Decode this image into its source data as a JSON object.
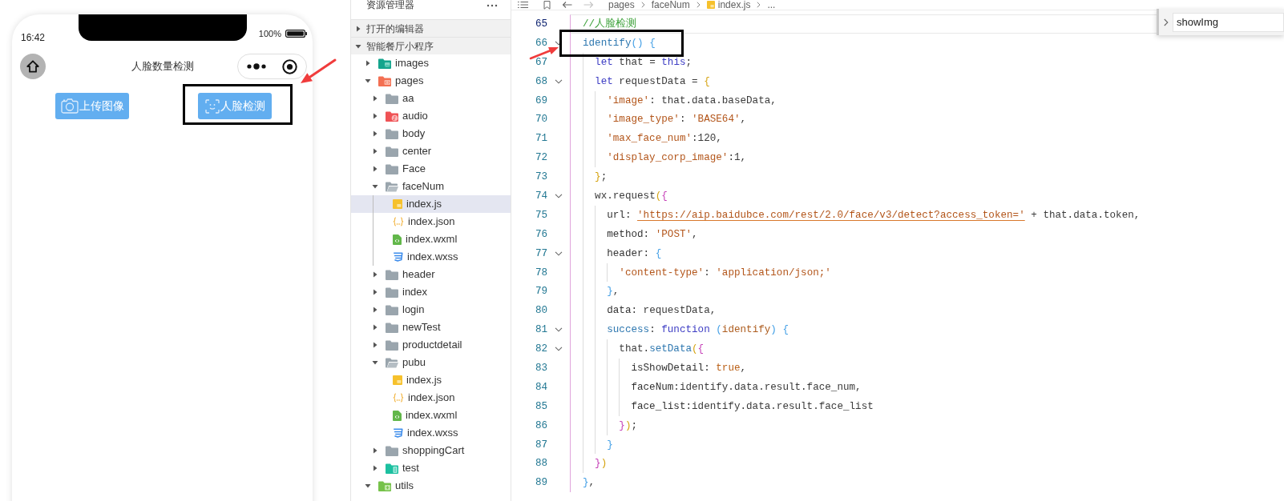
{
  "phone": {
    "status_bar": {
      "time": "16:42",
      "battery": "100%"
    },
    "nav_bar": {
      "title": "人脸数量检测"
    },
    "buttons": [
      {
        "label": "上传图像",
        "kind": "camera"
      },
      {
        "label": "人脸检测",
        "kind": "face-scan"
      }
    ]
  },
  "explorer": {
    "title": "资源管理器",
    "sections": [
      {
        "label": "打开的编辑器",
        "expanded": false
      },
      {
        "label": "智能餐厅小程序",
        "expanded": true,
        "children": [
          {
            "label": "images",
            "kind": "images",
            "expanded": false,
            "selected": false
          },
          {
            "label": "pages",
            "kind": "pages",
            "expanded": true,
            "selected": false,
            "children": [
              {
                "label": "aa",
                "kind": "folder",
                "expanded": false,
                "selected": false
              },
              {
                "label": "audio",
                "kind": "audio",
                "expanded": false,
                "selected": false
              },
              {
                "label": "body",
                "kind": "folder",
                "expanded": false,
                "selected": false
              },
              {
                "label": "center",
                "kind": "folder",
                "expanded": false,
                "selected": false
              },
              {
                "label": "Face",
                "kind": "folder",
                "expanded": false,
                "selected": false
              },
              {
                "label": "faceNum",
                "kind": "folder",
                "expanded": true,
                "selected": false,
                "children": [
                  {
                    "label": "index.js",
                    "kind": "js",
                    "selected": true
                  },
                  {
                    "label": "index.json",
                    "kind": "json",
                    "selected": false
                  },
                  {
                    "label": "index.wxml",
                    "kind": "wxml",
                    "selected": false
                  },
                  {
                    "label": "index.wxss",
                    "kind": "wxss",
                    "selected": false
                  }
                ]
              },
              {
                "label": "header",
                "kind": "folder",
                "expanded": false,
                "selected": false
              },
              {
                "label": "index",
                "kind": "folder",
                "expanded": false,
                "selected": false
              },
              {
                "label": "login",
                "kind": "folder",
                "expanded": false,
                "selected": false
              },
              {
                "label": "newTest",
                "kind": "folder",
                "expanded": false,
                "selected": false
              },
              {
                "label": "productdetail",
                "kind": "folder",
                "expanded": false,
                "selected": false
              },
              {
                "label": "pubu",
                "kind": "folder",
                "expanded": true,
                "selected": false,
                "children": [
                  {
                    "label": "index.js",
                    "kind": "js",
                    "selected": false
                  },
                  {
                    "label": "index.json",
                    "kind": "json",
                    "selected": false
                  },
                  {
                    "label": "index.wxml",
                    "kind": "wxml",
                    "selected": false
                  },
                  {
                    "label": "index.wxss",
                    "kind": "wxss",
                    "selected": false
                  }
                ]
              },
              {
                "label": "shoppingCart",
                "kind": "folder",
                "expanded": false,
                "selected": false
              },
              {
                "label": "test",
                "kind": "test",
                "expanded": false,
                "selected": false
              }
            ]
          },
          {
            "label": "utils",
            "kind": "utils",
            "expanded": true,
            "selected": false
          }
        ]
      }
    ]
  },
  "editor": {
    "breadcrumb": [
      {
        "label": "pages",
        "kind": "folder"
      },
      {
        "label": "faceNum",
        "kind": "folder"
      },
      {
        "label": "index.js",
        "kind": "js"
      },
      {
        "label": "...",
        "kind": "more"
      }
    ],
    "lines": [
      {
        "number": "65",
        "current": true,
        "tokens": [
          {
            "kind": "comment",
            "text": "//人脸检测"
          }
        ]
      },
      {
        "number": "66",
        "current": false,
        "expanded": true,
        "tokens": [
          {
            "kind": "function",
            "text": "identify"
          },
          {
            "kind": "b3",
            "text": "() {"
          }
        ],
        "children": [
          {
            "number": "67",
            "current": false,
            "tokens": [
              {
                "kind": "keyword",
                "text": "let"
              },
              {
                "kind": "plain",
                "text": " that = "
              },
              {
                "kind": "keyword",
                "text": "this"
              },
              {
                "kind": "plain",
                "text": ";"
              }
            ]
          },
          {
            "number": "68",
            "current": false,
            "expanded": true,
            "tokens": [
              {
                "kind": "keyword",
                "text": "let"
              },
              {
                "kind": "plain",
                "text": " requestData = "
              },
              {
                "kind": "b1",
                "text": "{"
              }
            ],
            "children": [
              {
                "number": "69",
                "current": false,
                "tokens": [
                  {
                    "kind": "string",
                    "text": "'image'"
                  },
                  {
                    "kind": "plain",
                    "text": ": that.data.baseData,"
                  }
                ]
              },
              {
                "number": "70",
                "current": false,
                "tokens": [
                  {
                    "kind": "string",
                    "text": "'image_type'"
                  },
                  {
                    "kind": "plain",
                    "text": ": "
                  },
                  {
                    "kind": "string",
                    "text": "'BASE64'"
                  },
                  {
                    "kind": "plain",
                    "text": ","
                  }
                ]
              },
              {
                "number": "71",
                "current": false,
                "tokens": [
                  {
                    "kind": "string",
                    "text": "'max_face_num'"
                  },
                  {
                    "kind": "plain",
                    "text": ":120,"
                  }
                ]
              },
              {
                "number": "72",
                "current": false,
                "tokens": [
                  {
                    "kind": "string",
                    "text": "'display_corp_image'"
                  },
                  {
                    "kind": "plain",
                    "text": ":1,"
                  }
                ]
              }
            ]
          },
          {
            "number": "73",
            "current": false,
            "tokens": [
              {
                "kind": "b1",
                "text": "}"
              },
              {
                "kind": "plain",
                "text": ";"
              }
            ]
          },
          {
            "number": "74",
            "current": false,
            "expanded": true,
            "tokens": [
              {
                "kind": "plain",
                "text": "wx.request"
              },
              {
                "kind": "b1",
                "text": "("
              },
              {
                "kind": "b2",
                "text": "{"
              }
            ],
            "children": [
              {
                "number": "75",
                "current": false,
                "tokens": [
                  {
                    "kind": "prop",
                    "text": "url"
                  },
                  {
                    "kind": "plain",
                    "text": ": "
                  },
                  {
                    "kind": "url",
                    "text": "'https://aip.baidubce.com/rest/2.0/face/v3/detect?access_token='"
                  },
                  {
                    "kind": "plain",
                    "text": " + that.data.token,"
                  }
                ]
              },
              {
                "number": "76",
                "current": false,
                "tokens": [
                  {
                    "kind": "prop",
                    "text": "method"
                  },
                  {
                    "kind": "plain",
                    "text": ": "
                  },
                  {
                    "kind": "string",
                    "text": "'POST'"
                  },
                  {
                    "kind": "plain",
                    "text": ","
                  }
                ]
              },
              {
                "number": "77",
                "current": false,
                "expanded": true,
                "tokens": [
                  {
                    "kind": "prop",
                    "text": "header"
                  },
                  {
                    "kind": "plain",
                    "text": ": "
                  },
                  {
                    "kind": "b3",
                    "text": "{"
                  }
                ],
                "children": [
                  {
                    "number": "78",
                    "current": false,
                    "tokens": [
                      {
                        "kind": "string",
                        "text": "'content-type'"
                      },
                      {
                        "kind": "plain",
                        "text": ": "
                      },
                      {
                        "kind": "string",
                        "text": "'application/json;'"
                      }
                    ]
                  }
                ]
              },
              {
                "number": "79",
                "current": false,
                "tokens": [
                  {
                    "kind": "b3",
                    "text": "}"
                  },
                  {
                    "kind": "plain",
                    "text": ","
                  }
                ]
              },
              {
                "number": "80",
                "current": false,
                "tokens": [
                  {
                    "kind": "prop",
                    "text": "data"
                  },
                  {
                    "kind": "plain",
                    "text": ": requestData,"
                  }
                ]
              },
              {
                "number": "81",
                "current": false,
                "expanded": true,
                "tokens": [
                  {
                    "kind": "method",
                    "text": "success"
                  },
                  {
                    "kind": "plain",
                    "text": ": "
                  },
                  {
                    "kind": "keyword",
                    "text": "function"
                  },
                  {
                    "kind": "b3",
                    "text": " ("
                  },
                  {
                    "kind": "param",
                    "text": "identify"
                  },
                  {
                    "kind": "b3",
                    "text": ") {"
                  }
                ],
                "children": [
                  {
                    "number": "82",
                    "current": false,
                    "expanded": true,
                    "tokens": [
                      {
                        "kind": "plain",
                        "text": "that."
                      },
                      {
                        "kind": "method",
                        "text": "setData"
                      },
                      {
                        "kind": "b1",
                        "text": "("
                      },
                      {
                        "kind": "b2",
                        "text": "{"
                      }
                    ],
                    "children": [
                      {
                        "number": "83",
                        "current": false,
                        "tokens": [
                          {
                            "kind": "prop",
                            "text": "isShowDetail"
                          },
                          {
                            "kind": "plain",
                            "text": ": "
                          },
                          {
                            "kind": "bool",
                            "text": "true"
                          },
                          {
                            "kind": "plain",
                            "text": ","
                          }
                        ]
                      },
                      {
                        "number": "84",
                        "current": false,
                        "tokens": [
                          {
                            "kind": "prop",
                            "text": "faceNum"
                          },
                          {
                            "kind": "plain",
                            "text": ":identify.data.result.face_num,"
                          }
                        ]
                      },
                      {
                        "number": "85",
                        "current": false,
                        "tokens": [
                          {
                            "kind": "prop",
                            "text": "face_list"
                          },
                          {
                            "kind": "plain",
                            "text": ":identify.data.result.face_list"
                          }
                        ]
                      }
                    ]
                  },
                  {
                    "number": "86",
                    "current": false,
                    "tokens": [
                      {
                        "kind": "b2",
                        "text": "}"
                      },
                      {
                        "kind": "b1",
                        "text": ")"
                      },
                      {
                        "kind": "plain",
                        "text": ";"
                      }
                    ]
                  }
                ]
              },
              {
                "number": "87",
                "current": false,
                "tokens": [
                  {
                    "kind": "b3",
                    "text": "}"
                  }
                ]
              }
            ]
          },
          {
            "number": "88",
            "current": false,
            "tokens": [
              {
                "kind": "b2",
                "text": "}"
              },
              {
                "kind": "b1",
                "text": ")"
              }
            ]
          }
        ]
      },
      {
        "number": "89",
        "current": false,
        "tokens": [
          {
            "kind": "b3",
            "text": "}"
          },
          {
            "kind": "plain",
            "text": ","
          }
        ]
      }
    ],
    "find_widget": {
      "value": "showImg",
      "expanded": false
    }
  }
}
